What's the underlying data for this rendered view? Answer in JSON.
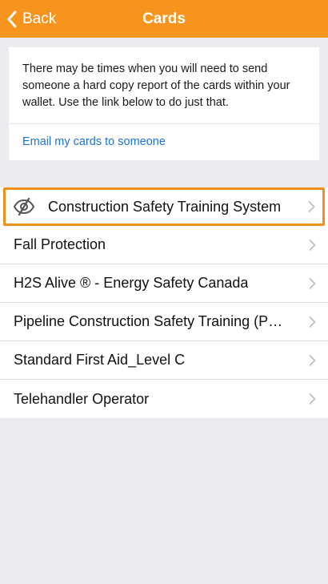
{
  "header": {
    "back_label": "Back",
    "title": "Cards",
    "accent_color": "#f7941d"
  },
  "info": {
    "text": "There may be times when you will need to send someone a hard copy report of the cards within your wallet. Use the link below to do just that.",
    "email_link": "Email my cards to someone"
  },
  "cards": [
    {
      "label": "Construction Safety Training System",
      "icon": "eye-slash-icon",
      "highlighted": true
    },
    {
      "label": "Fall Protection"
    },
    {
      "label": "H2S Alive ® - Energy Safety Canada"
    },
    {
      "label": "Pipeline Construction Safety Training (PCST)"
    },
    {
      "label": "Standard First Aid_Level C"
    },
    {
      "label": "Telehandler Operator"
    }
  ]
}
